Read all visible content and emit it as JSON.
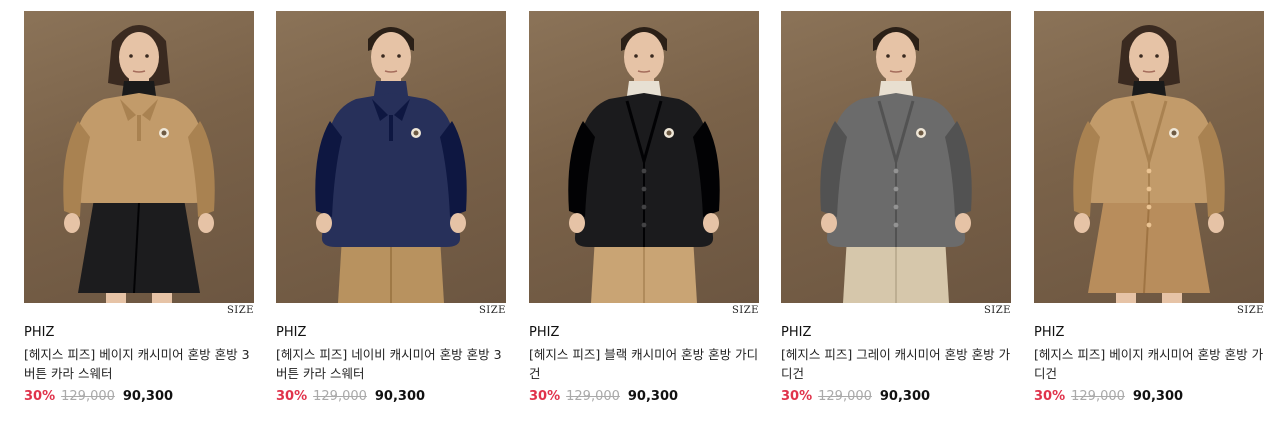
{
  "size_label": "SIZE",
  "products": [
    {
      "brand": "PHIZ",
      "title": "[헤지스 피즈] 베이지 캐시미어 혼방 혼방 3버튼 카라 스웨터",
      "discount": "30%",
      "original_price": "129,000",
      "sale_price": "90,300",
      "model": "female",
      "garment": "polo-sweater",
      "top_color": "#c29b6a",
      "neck_color": "#1a1a1a",
      "bottom_color": "#1c1c1e",
      "bottom_type": "skirt"
    },
    {
      "brand": "PHIZ",
      "title": "[헤지스 피즈] 네이비 캐시미어 혼방 혼방 3버튼 카라 스웨터",
      "discount": "30%",
      "original_price": "129,000",
      "sale_price": "90,300",
      "model": "male",
      "garment": "polo-sweater",
      "top_color": "#27305a",
      "neck_color": "#27305a",
      "bottom_color": "#b8925f",
      "bottom_type": "pants"
    },
    {
      "brand": "PHIZ",
      "title": "[헤지스 피즈] 블랙 캐시미어 혼방 혼방 가디건",
      "discount": "30%",
      "original_price": "129,000",
      "sale_price": "90,300",
      "model": "male",
      "garment": "cardigan",
      "top_color": "#1b1b1d",
      "neck_color": "#e7e0d3",
      "bottom_color": "#c9a474",
      "bottom_type": "pants"
    },
    {
      "brand": "PHIZ",
      "title": "[헤지스 피즈] 그레이 캐시미어 혼방 혼방 가디건",
      "discount": "30%",
      "original_price": "129,000",
      "sale_price": "90,300",
      "model": "male",
      "garment": "cardigan",
      "top_color": "#6b6b6b",
      "neck_color": "#e8dfd0",
      "bottom_color": "#d6c7ab",
      "bottom_type": "pants"
    },
    {
      "brand": "PHIZ",
      "title": "[헤지스 피즈] 베이지 캐시미어 혼방 혼방 가디건",
      "discount": "30%",
      "original_price": "129,000",
      "sale_price": "90,300",
      "model": "female",
      "garment": "cardigan",
      "top_color": "#c29b6a",
      "neck_color": "#1a1a1a",
      "bottom_color": "#b88d5c",
      "bottom_type": "skirt"
    }
  ]
}
